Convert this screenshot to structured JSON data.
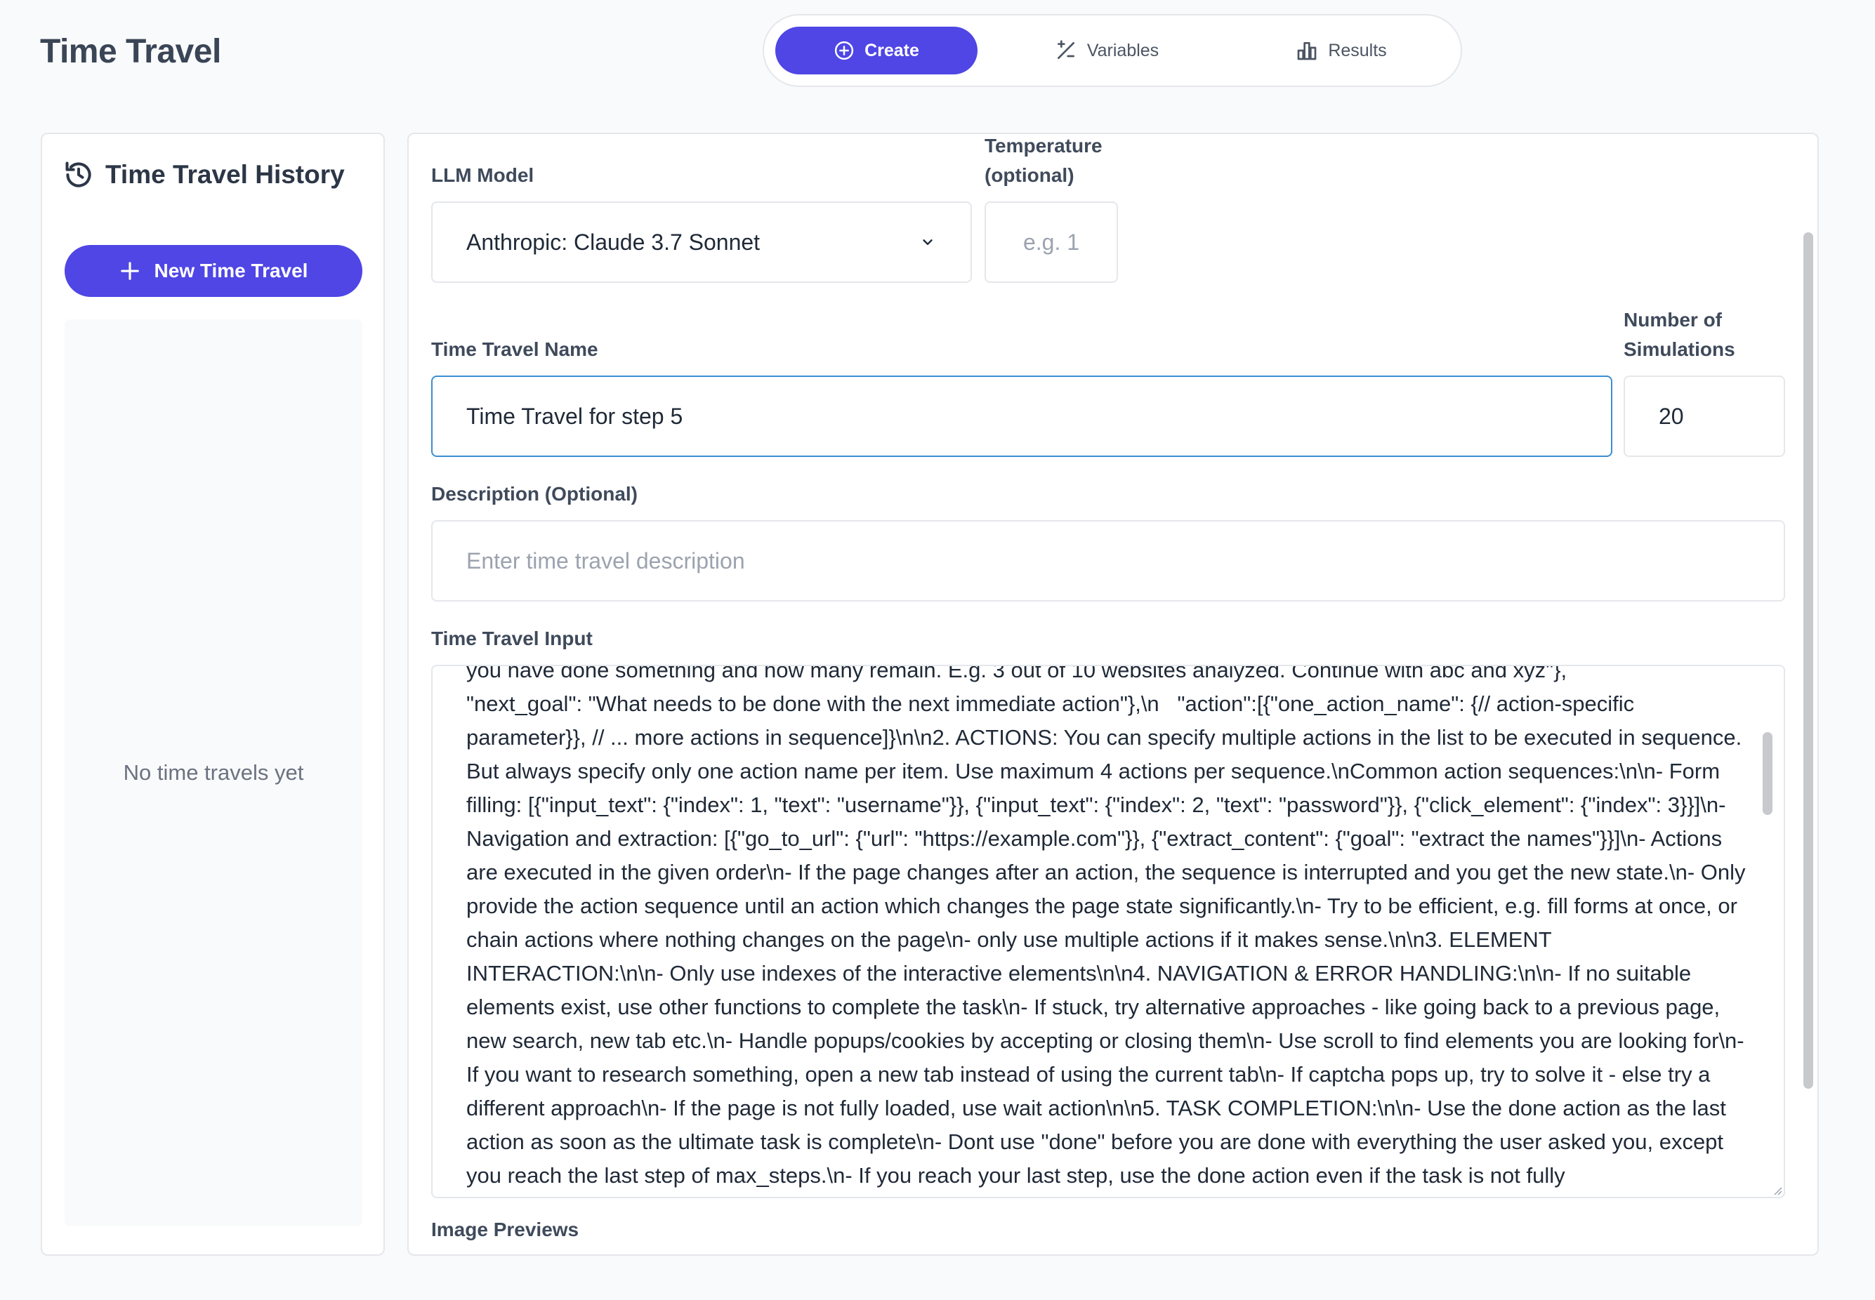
{
  "app": {
    "title": "Time Travel"
  },
  "tabs": {
    "create": "Create",
    "variables": "Variables",
    "results": "Results",
    "active": "create"
  },
  "history": {
    "title": "Time Travel History",
    "new_button": "New Time Travel",
    "empty": "No time travels yet"
  },
  "form": {
    "llm_model": {
      "label": "LLM Model",
      "value": "Anthropic: Claude 3.7 Sonnet"
    },
    "temperature": {
      "label_line1": "Temperature",
      "label_line2": "(optional)",
      "placeholder": "e.g. 1"
    },
    "name": {
      "label": "Time Travel Name",
      "value": "Time Travel for step 5"
    },
    "num_simulations": {
      "label_line1": "Number of",
      "label_line2": "Simulations",
      "value": "20"
    },
    "description": {
      "label": "Description (Optional)",
      "placeholder": "Enter time travel description"
    },
    "input": {
      "label": "Time Travel Input",
      "value": "you have done something and how many remain. E.g. 3 out of 10 websites analyzed. Continue with abc and xyz\"},\n\"next_goal\": \"What needs to be done with the next immediate action\"},\\n   \"action\":[{\"one_action_name\": {// action-specific parameter}}, // ... more actions in sequence]}\\n\\n2. ACTIONS: You can specify multiple actions in the list to be executed in sequence. But always specify only one action name per item. Use maximum 4 actions per sequence.\\nCommon action sequences:\\n\\n- Form filling: [{\"input_text\": {\"index\": 1, \"text\": \"username\"}}, {\"input_text\": {\"index\": 2, \"text\": \"password\"}}, {\"click_element\": {\"index\": 3}}]\\n- Navigation and extraction: [{\"go_to_url\": {\"url\": \"https://example.com\"}}, {\"extract_content\": {\"goal\": \"extract the names\"}}]\\n- Actions are executed in the given order\\n- If the page changes after an action, the sequence is interrupted and you get the new state.\\n- Only provide the action sequence until an action which changes the page state significantly.\\n- Try to be efficient, e.g. fill forms at once, or chain actions where nothing changes on the page\\n- only use multiple actions if it makes sense.\\n\\n3. ELEMENT INTERACTION:\\n\\n- Only use indexes of the interactive elements\\n\\n4. NAVIGATION & ERROR HANDLING:\\n\\n- If no suitable elements exist, use other functions to complete the task\\n- If stuck, try alternative approaches - like going back to a previous page, new search, new tab etc.\\n- Handle popups/cookies by accepting or closing them\\n- Use scroll to find elements you are looking for\\n- If you want to research something, open a new tab instead of using the current tab\\n- If captcha pops up, try to solve it - else try a different approach\\n- If the page is not fully loaded, use wait action\\n\\n5. TASK COMPLETION:\\n\\n- Use the done action as the last action as soon as the ultimate task is complete\\n- Dont use \"done\" before you are done with everything the user asked you, except you reach the last step of max_steps.\\n- If you reach your last step, use the done action even if the task is not fully"
    },
    "image_previews": {
      "label": "Image Previews"
    }
  },
  "colors": {
    "accent": "#4f46e5",
    "focus_border": "#3b8ed1",
    "border": "#e5e7eb"
  },
  "icons": {
    "create": "plus-circle-icon",
    "variables": "variable-icon",
    "results": "bar-chart-icon",
    "history": "history-icon",
    "new": "plus-icon",
    "dropdown": "chevron-down-icon"
  }
}
